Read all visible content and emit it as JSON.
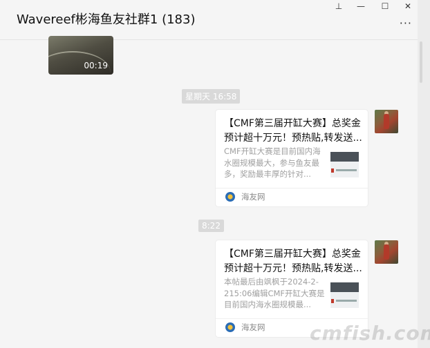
{
  "window": {
    "title": "Wavereef彬海鱼友社群1 (183)",
    "controls": {
      "pin": "⊥",
      "minimize": "—",
      "maximize": "☐",
      "close": "✕"
    },
    "more": "···"
  },
  "chat": {
    "video": {
      "duration": "00:19"
    },
    "messages": [
      {
        "timestamp": "星期天 16:58",
        "card": {
          "title": "【CMF第三届开缸大赛】总奖金预计超十万元！预热贴,转发送...",
          "description": "CMF开缸大赛是目前国内海水圈规模最大，参与鱼友最多，奖励最丰厚的针对...",
          "source": "海友网"
        }
      },
      {
        "timestamp": "8:22",
        "card": {
          "title": "【CMF第三届开缸大赛】总奖金预计超十万元！预热贴,转发送...",
          "description": "本帖最后由飒枫于2024-2-215:06编辑CMF开缸大赛是目前国内海水圈规模最...",
          "source": "海友网"
        }
      }
    ]
  },
  "watermark": "cmfish.com"
}
